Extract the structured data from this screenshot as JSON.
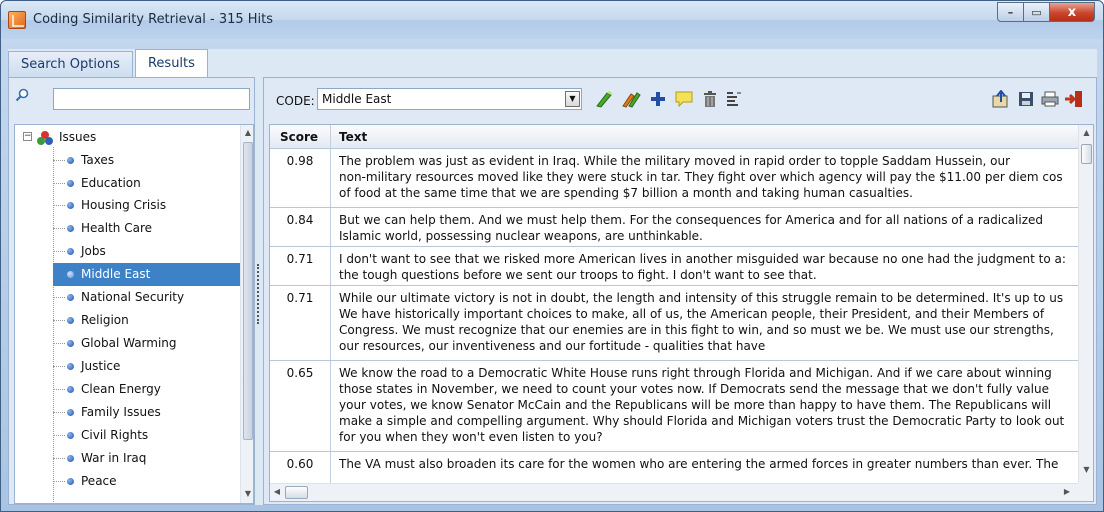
{
  "window": {
    "title": "Coding Similarity Retrieval - 315 Hits",
    "controls": {
      "minimize": "–",
      "maximize": "▭",
      "close": "x"
    }
  },
  "tabs": [
    {
      "label": "Search Options",
      "active": false
    },
    {
      "label": "Results",
      "active": true
    }
  ],
  "search": {
    "value": "",
    "placeholder": ""
  },
  "tree": {
    "root": {
      "label": "Issues",
      "expander": "−"
    },
    "items": [
      {
        "label": "Taxes"
      },
      {
        "label": "Education"
      },
      {
        "label": "Housing Crisis"
      },
      {
        "label": "Health Care"
      },
      {
        "label": "Jobs"
      },
      {
        "label": "Middle East",
        "selected": true
      },
      {
        "label": "National Security"
      },
      {
        "label": "Religion"
      },
      {
        "label": "Global Warming"
      },
      {
        "label": "Justice"
      },
      {
        "label": "Clean Energy"
      },
      {
        "label": "Family Issues"
      },
      {
        "label": "Civil Rights"
      },
      {
        "label": "War in Iraq"
      },
      {
        "label": "Peace"
      }
    ]
  },
  "toolbar": {
    "code_label": "CODE:",
    "code_value": "Middle East",
    "icons": [
      "code-green-icon",
      "code-orange-icon",
      "add-icon",
      "memo-icon",
      "delete-icon",
      "list-icon",
      "export-icon",
      "save-icon",
      "print-icon",
      "exit-icon"
    ]
  },
  "results": {
    "headers": {
      "score": "Score",
      "text": "Text"
    },
    "rows": [
      {
        "score": "0.98",
        "lines": [
          "The problem was just as evident in Iraq. While the military moved in rapid order to topple Saddam Hussein, our",
          "non-military resources moved like they were stuck in tar. They fight over which agency will pay the $11.00 per diem cos",
          "of food at the same time that we are spending $7 billion a month and taking human casualties."
        ]
      },
      {
        "score": "0.84",
        "lines": [
          "But we can help them. And we must help them. For the consequences for America and for all nations of a radicalized",
          "Islamic world, possessing nuclear weapons, are unthinkable."
        ]
      },
      {
        "score": "0.71",
        "lines": [
          "I don't want to see that we risked more American lives in another misguided war because no one had the judgment to a:",
          "the tough questions before we sent our troops to fight. I don't want to see that."
        ]
      },
      {
        "score": "0.71",
        "lines": [
          "While our ultimate victory is not in doubt, the length and intensity of this struggle remain to be determined. It's up to us",
          "We have historically important choices to make, all of us, the American people, their President, and their Members of",
          "Congress. We must recognize that our enemies are in this fight to win, and so must we be. We must use our strengths,",
          "our resources, our inventiveness and our fortitude - qualities that have"
        ]
      },
      {
        "score": "0.65",
        "lines": [
          "We know the road to a Democratic White House runs right through Florida and Michigan. And if we care about winning",
          "those states in November, we need to count your votes now. If Democrats send the message that we don't fully value",
          "your votes, we know Senator McCain and the Republicans will be more than happy to have them. The Republicans will",
          "make a simple and compelling argument. Why should Florida and Michigan voters trust the Democratic Party to look out",
          "for you when they won't even listen to you?"
        ]
      },
      {
        "score": "0.60",
        "lines": [
          "The VA must also broaden its care for the women who are entering the armed forces in greater numbers than ever. The"
        ]
      }
    ]
  }
}
